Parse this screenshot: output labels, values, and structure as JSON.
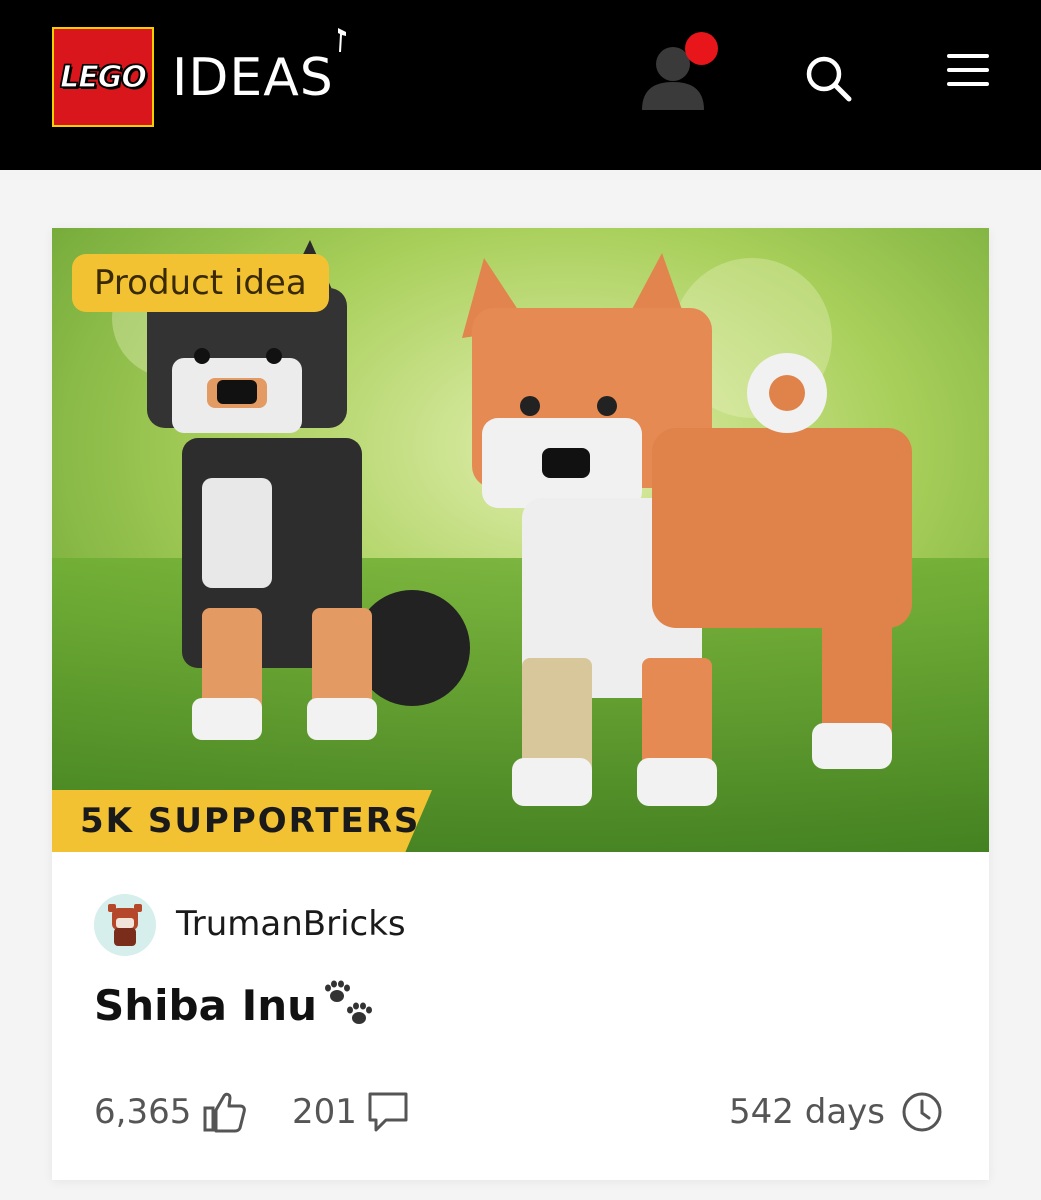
{
  "header": {
    "logo_text": "LEGO",
    "brand_text": "IDEAS",
    "colors": {
      "background": "#000000",
      "logo_red": "#d9161b",
      "notification": "#e8151b"
    },
    "icons": [
      "user-icon",
      "notification-dot",
      "search-icon",
      "menu-icon"
    ]
  },
  "card": {
    "badge_label": "Product idea",
    "supporters_label": "5K SUPPORTERS",
    "author": "TrumanBricks",
    "title": "Shiba Inu",
    "title_icon": "paw-prints-icon",
    "likes": "6,365",
    "comments": "201",
    "days": "542 days",
    "colors": {
      "accent": "#f3c233"
    }
  }
}
